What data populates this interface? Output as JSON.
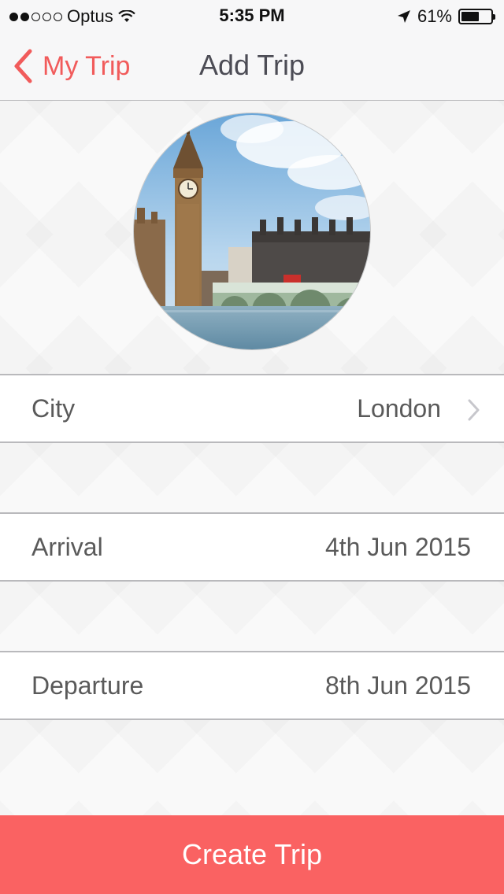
{
  "status_bar": {
    "carrier": "Optus",
    "time": "5:35 PM",
    "battery": "61%",
    "battery_level": 0.61,
    "signal_bars": 2,
    "signal_total": 5
  },
  "nav": {
    "back_label": "My Trip",
    "title": "Add Trip"
  },
  "form": {
    "city": {
      "label": "City",
      "value": "London"
    },
    "arrival": {
      "label": "Arrival",
      "value": "4th Jun 2015"
    },
    "departure": {
      "label": "Departure",
      "value": "8th Jun 2015"
    }
  },
  "create_button": {
    "label": "Create Trip"
  },
  "colors": {
    "accent": "#f15b5b",
    "button": "#fa6262",
    "divider": "#b9b9bc"
  },
  "icons": [
    "wifi-icon",
    "location-arrow-icon",
    "battery-icon",
    "back-chevron-icon",
    "chevron-right-icon"
  ]
}
